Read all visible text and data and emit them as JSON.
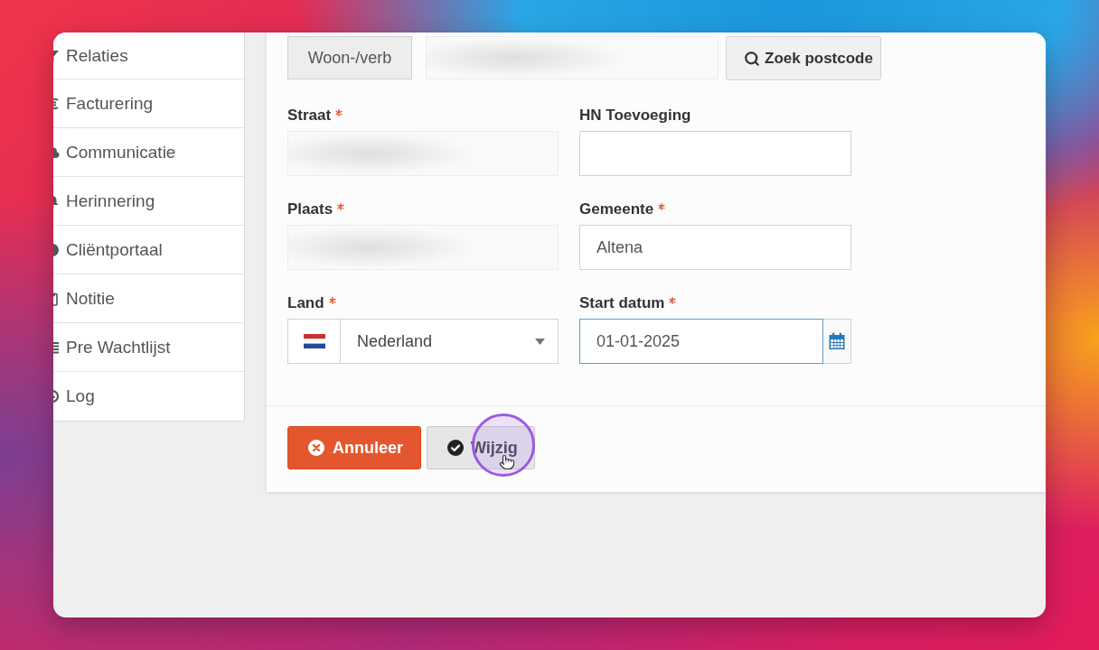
{
  "sidebar": {
    "items": [
      {
        "label": "Relaties"
      },
      {
        "label": "Facturering"
      },
      {
        "label": "Communicatie"
      },
      {
        "label": "Herinnering"
      },
      {
        "label": "Cliëntportaal"
      },
      {
        "label": "Notitie"
      },
      {
        "label": "Pre Wachtlijst"
      },
      {
        "label": "Log"
      }
    ]
  },
  "form": {
    "address_lookup": {
      "addon": "Woon-/verb",
      "blurred": true,
      "button": "Zoek postcode"
    },
    "fields": [
      {
        "kind": "text",
        "label": "Straat",
        "required": true,
        "blurred": true,
        "focused": false
      },
      {
        "kind": "text",
        "label": "HN Toevoeging",
        "required": false,
        "blurred": false,
        "focused": false
      },
      {
        "kind": "text",
        "label": "Plaats",
        "required": true,
        "blurred": true,
        "focused": false
      },
      {
        "kind": "text",
        "label": "Gemeente",
        "required": true,
        "blurred": false,
        "focused": false,
        "value": "Altena"
      },
      {
        "kind": "select",
        "label": "Land",
        "required": true,
        "blurred": false,
        "focused": false,
        "value": "Nederland"
      },
      {
        "kind": "date",
        "label": "Start datum",
        "required": true,
        "blurred": false,
        "focused": true,
        "value": "01-01-2025"
      }
    ],
    "buttons": [
      {
        "kind": "cancel",
        "label": "Annuleer",
        "clicked": false
      },
      {
        "kind": "confirm",
        "label": "Wijzig",
        "clicked": true
      }
    ]
  }
}
